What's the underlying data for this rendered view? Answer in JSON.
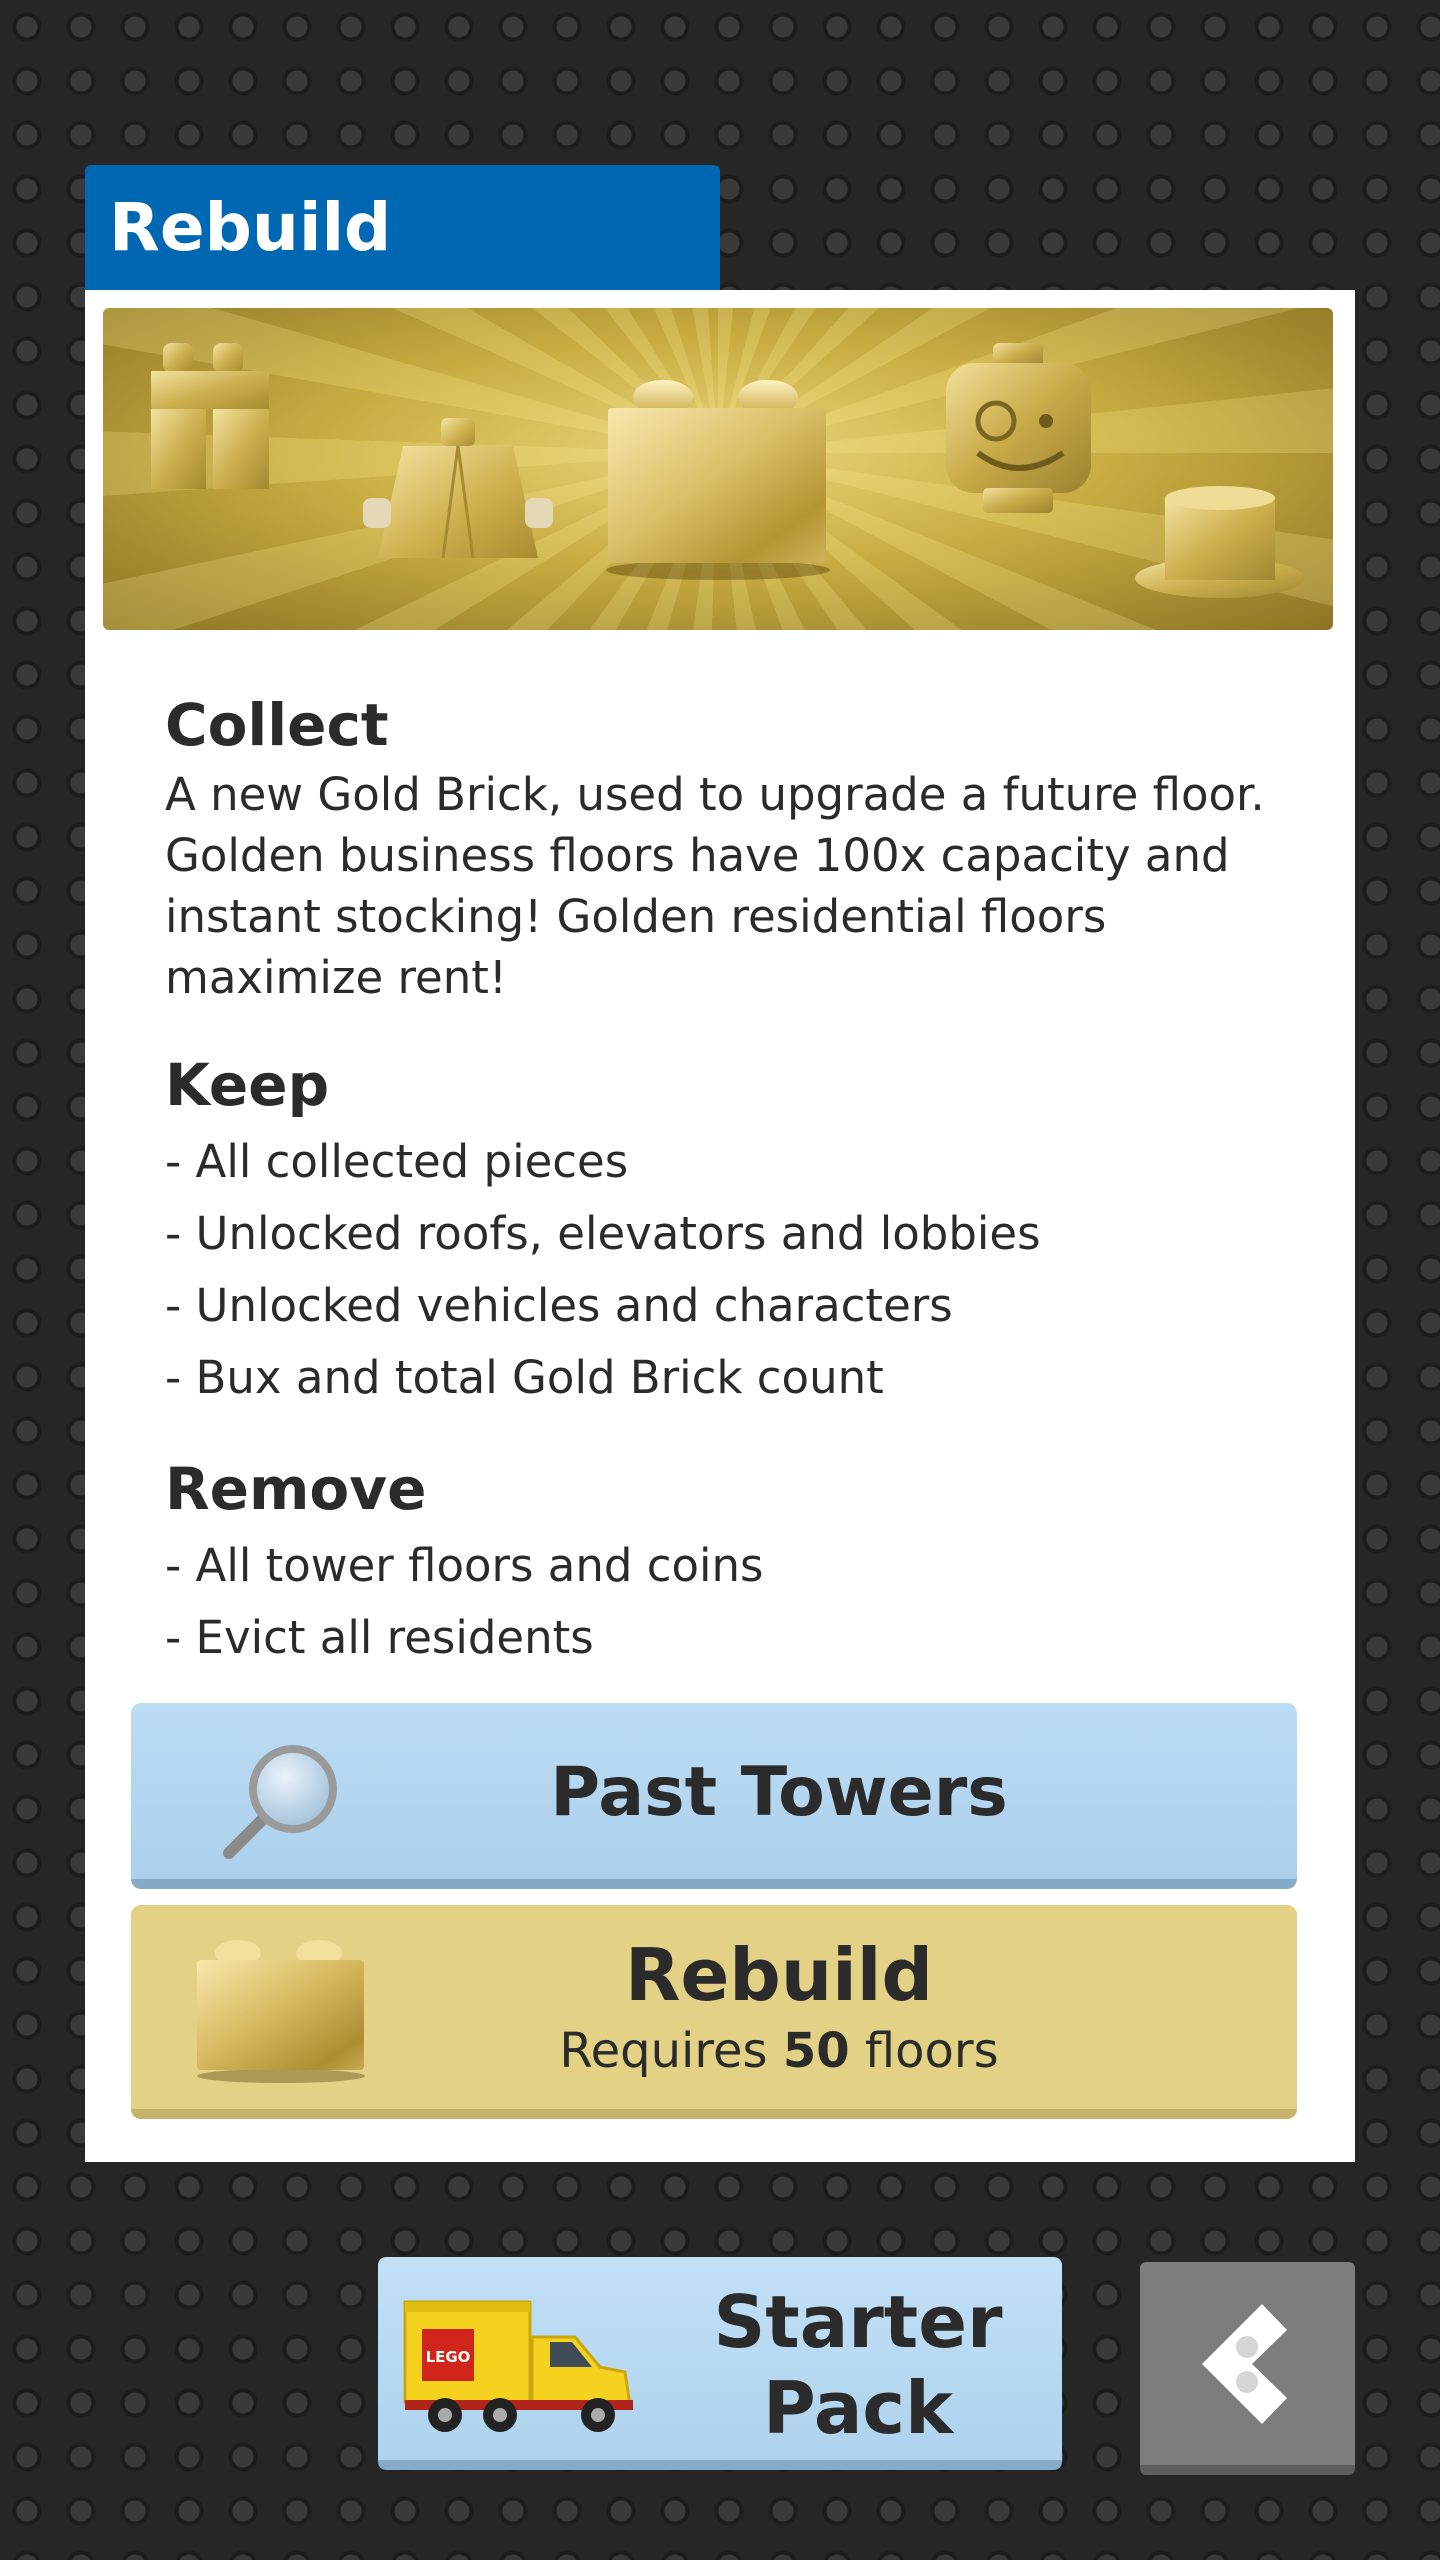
{
  "tab": {
    "title": "Rebuild"
  },
  "collect": {
    "heading": "Collect",
    "text": "A new Gold Brick, used to upgrade a future floor. Golden business floors have 100x capacity and instant stocking! Golden residential floors maximize rent!"
  },
  "keep": {
    "heading": "Keep",
    "items": [
      "- All collected pieces",
      "- Unlocked roofs, elevators and lobbies",
      "- Unlocked vehicles and characters",
      "- Bux and total Gold Brick count"
    ]
  },
  "remove": {
    "heading": "Remove",
    "items": [
      "- All tower floors and coins",
      "- Evict all residents"
    ]
  },
  "buttons": {
    "past_towers": "Past Towers",
    "rebuild": "Rebuild",
    "requires_prefix": "Requires ",
    "requires_count": "50",
    "requires_suffix": " floors"
  },
  "starter_pack": {
    "line1": "Starter",
    "line2": "Pack",
    "logo": "LEGO"
  },
  "icons": {
    "search": "magnifier-icon",
    "brick": "gold-brick-icon",
    "truck": "lego-truck-icon",
    "back": "back-arrow-icon"
  },
  "colors": {
    "tab_blue": "#0067b3",
    "button_blue": "#b5d7f1",
    "button_gold": "#e3d185",
    "back_gray": "#7d7d7d"
  }
}
